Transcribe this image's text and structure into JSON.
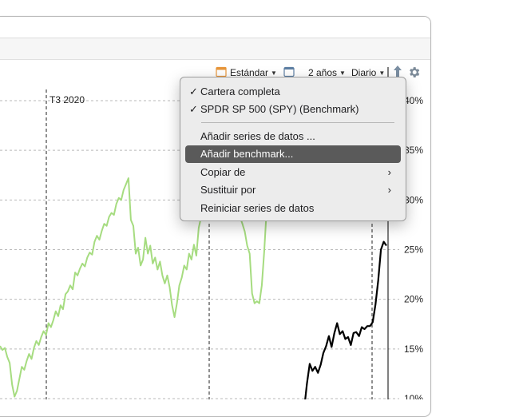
{
  "toolbar": {
    "view_label": "Estándar",
    "period_label": "2 años",
    "interval_label": "Diario"
  },
  "icons": {
    "view": "calendar-icon",
    "window": "window-icon",
    "export": "export-arrow-icon",
    "settings": "gear-icon"
  },
  "colors": {
    "portfolio_series": "#a6dc80",
    "benchmark_series": "#000000",
    "view_icon_accent": "#e8963a",
    "menu_highlight": "#5a5a5a"
  },
  "chart_data": {
    "type": "line",
    "y_axis_position": "right",
    "y_ticks": [
      "40%",
      "35%",
      "30%",
      "25%",
      "20%",
      "15%",
      "10%"
    ],
    "y_tick_values": [
      40,
      35,
      30,
      25,
      20,
      15,
      10
    ],
    "grid": true,
    "x_markers": [
      {
        "label": "T3 2020"
      }
    ],
    "series": [
      {
        "color": "#a6dc80",
        "values": [
          15.3,
          14.9,
          15.1,
          14.2,
          13.6,
          11.4,
          10.2,
          10.8,
          12.0,
          13.2,
          12.9,
          13.8,
          14.5,
          14.0,
          15.1,
          15.8,
          15.4,
          16.2,
          16.8,
          16.4,
          17.6,
          17.2,
          17.9,
          18.8,
          18.3,
          19.4,
          19.0,
          20.5,
          20.8,
          21.4,
          21.0,
          22.7,
          22.4,
          23.1,
          23.6,
          23.3,
          24.2,
          24.7,
          24.5,
          25.8,
          26.4,
          26.0,
          26.9,
          27.6,
          27.4,
          28.3,
          28.7,
          28.5,
          29.6,
          30.2,
          30.0,
          31.0,
          31.6,
          32.2,
          28.0,
          27.4,
          24.6,
          25.2,
          23.4,
          24.0,
          26.2,
          24.6,
          25.4,
          23.6,
          24.2,
          23.0,
          23.8,
          22.4,
          21.6,
          22.4,
          21.2,
          19.4,
          18.2,
          19.6,
          21.4,
          22.2,
          23.4,
          23.0,
          24.6,
          24.0,
          25.5,
          24.4,
          27.2,
          28.3,
          29.0,
          28.6,
          30.0,
          29.2,
          30.8,
          30.2,
          31.4,
          30.8,
          29.2,
          28.0,
          29.4,
          29.0,
          30.6,
          30.2,
          29.0,
          28.3,
          27.6,
          26.8,
          25.4,
          24.6,
          20.6,
          19.6,
          19.8,
          19.6,
          21.4,
          24.8,
          29.0,
          33.2,
          36.6
        ]
      },
      {
        "color": "#000000",
        "values": [
          9.0,
          11.5,
          13.5,
          12.8,
          13.2,
          12.6,
          13.4,
          14.6,
          15.3,
          16.3,
          15.2,
          16.6,
          17.6,
          16.5,
          16.8,
          16.0,
          16.2,
          15.4,
          16.6,
          16.7,
          16.3,
          17.2,
          17.0,
          17.3,
          17.3,
          17.7,
          19.5,
          21.9,
          25.0,
          25.8,
          25.4
        ]
      }
    ]
  },
  "menu": {
    "items": [
      {
        "label": "Cartera completa",
        "checked": true
      },
      {
        "label": "SPDR SP 500 (SPY) (Benchmark)",
        "checked": true
      },
      {
        "label": "Añadir series de datos ..."
      },
      {
        "label": "Añadir benchmark...",
        "highlighted": true
      },
      {
        "label": "Copiar de",
        "submenu": true
      },
      {
        "label": "Sustituir por",
        "submenu": true
      },
      {
        "label": "Reiniciar series de datos"
      }
    ],
    "check_mark": "✓",
    "submenu_arrow": "›"
  }
}
